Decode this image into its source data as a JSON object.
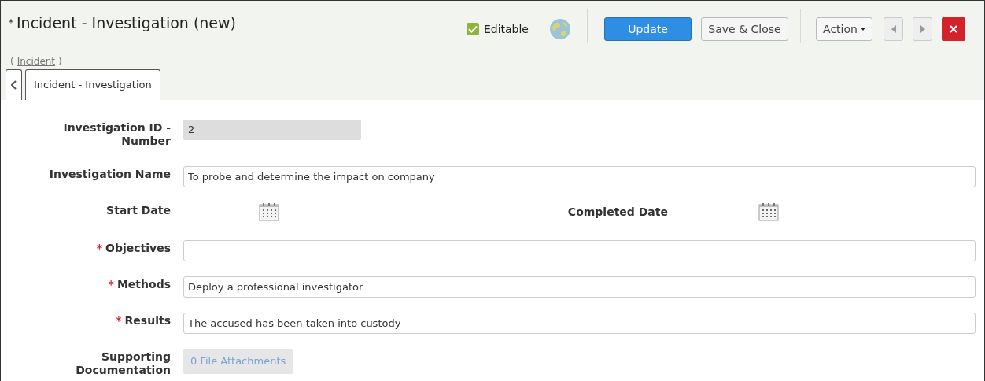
{
  "header": {
    "marker": "*",
    "title": "Incident - Investigation (new)",
    "editable": {
      "label": "Editable",
      "checked": true
    },
    "buttons": {
      "update": "Update",
      "save_close": "Save & Close",
      "action": "Action"
    },
    "breadcrumb": {
      "open": "(",
      "link": "Incident",
      "close": ")"
    }
  },
  "tabs": [
    {
      "label": "Incident - Investigation",
      "selected": true
    }
  ],
  "form": [
    {
      "kind": "readonly",
      "label": "Investigation ID - Number",
      "value": "2"
    },
    {
      "kind": "text",
      "label": "Investigation Name",
      "value": "To probe and determine the impact on company"
    },
    {
      "kind": "dates",
      "label": "Start Date",
      "label2": "Completed Date"
    },
    {
      "kind": "text",
      "label": "Objectives",
      "required_mark": "*"
    },
    {
      "kind": "text",
      "label": "Methods",
      "required_mark": "*",
      "value": "Deploy a professional investigator"
    },
    {
      "kind": "text",
      "label": "Results",
      "required_mark": "*",
      "value": "The accused has been taken into custody"
    },
    {
      "kind": "attachments",
      "label": "Supporting Documentation",
      "value": "0 File Attachments"
    }
  ]
}
